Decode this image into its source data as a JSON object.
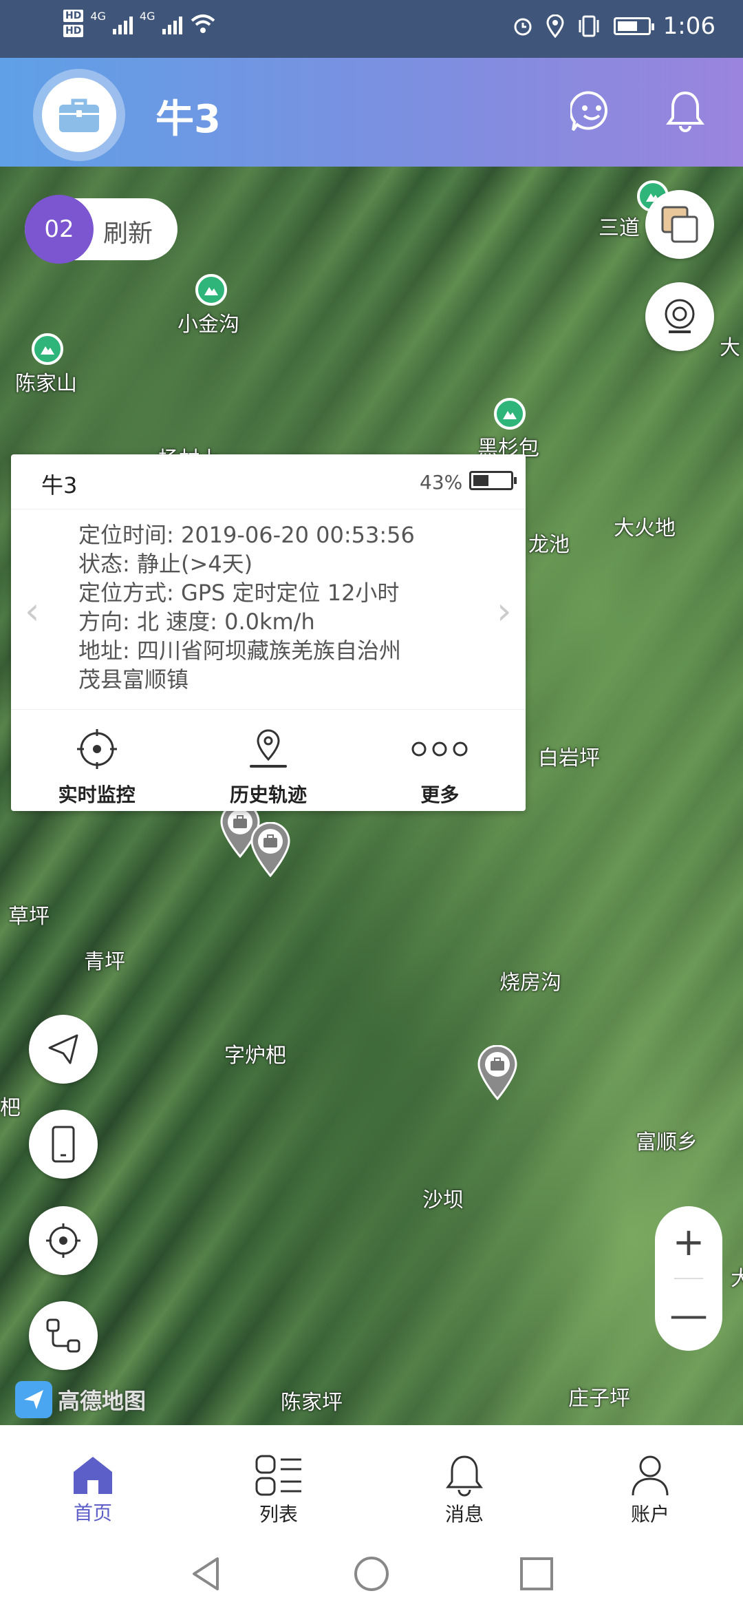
{
  "status_bar": {
    "hd_top": "HD",
    "hd_bottom": "HD",
    "net1": "4G",
    "net2": "4G",
    "time": "1:06"
  },
  "header": {
    "title": "牛3",
    "avatar_icon": "briefcase-icon",
    "right_icons": [
      "chat-bot-icon",
      "bell-icon"
    ]
  },
  "refresh": {
    "countdown": "02",
    "label": "刷新"
  },
  "map_labels": {
    "xiaojingou": "小金沟",
    "chenjiashan": "陈家山",
    "heishanbao": "黑杉包",
    "sandao": "三道",
    "da": "大",
    "qiaocun": "杨村上",
    "longchi": "龙池",
    "dahuodi": "大火地",
    "baiyanping": "白岩坪",
    "caoping": "草坪",
    "qingping": "青坪",
    "shaofanggou": "烧房沟",
    "zilouba": "字炉杷",
    "ba": "杷",
    "fushunxiang": "富顺乡",
    "shaba": "沙坝",
    "chenjiaping": "陈家坪",
    "zhuangziping": "庄子坪",
    "right_da": "大"
  },
  "map_logo": "高德地图",
  "card": {
    "name": "牛3",
    "battery_pct": "43%",
    "battery_level": 0.43,
    "lines": [
      "定位时间: 2019-06-20 00:53:56",
      "状态: 静止(>4天)",
      "定位方式: GPS  定时定位 12小时",
      "方向: 北  速度: 0.0km/h",
      "地址: 四川省阿坝藏族羌族自治州",
      "茂县富顺镇"
    ],
    "prev": "‹",
    "next": "›",
    "actions": [
      {
        "label": "实时监控",
        "icon": "crosshair-icon"
      },
      {
        "label": "历史轨迹",
        "icon": "location-pin-icon"
      },
      {
        "label": "更多",
        "icon": "more-dots-icon"
      }
    ]
  },
  "map_controls": {
    "layers": "layers-icon",
    "camera": "camera-icon",
    "navigate": "navigate-arrow-icon",
    "device": "phone-icon",
    "locate": "crosshair-icon",
    "route": "route-icon",
    "zoom_in": "+",
    "zoom_out": "—"
  },
  "bottom_nav": [
    {
      "label": "首页",
      "icon": "home-icon",
      "active": true
    },
    {
      "label": "列表",
      "icon": "list-icon",
      "active": false
    },
    {
      "label": "消息",
      "icon": "bell-icon",
      "active": false
    },
    {
      "label": "账户",
      "icon": "user-icon",
      "active": false
    }
  ],
  "colors": {
    "header_start": "#5fa0e6",
    "header_end": "#9a84de",
    "accent": "#7b56d0",
    "nav_active": "#5b5fc7"
  }
}
